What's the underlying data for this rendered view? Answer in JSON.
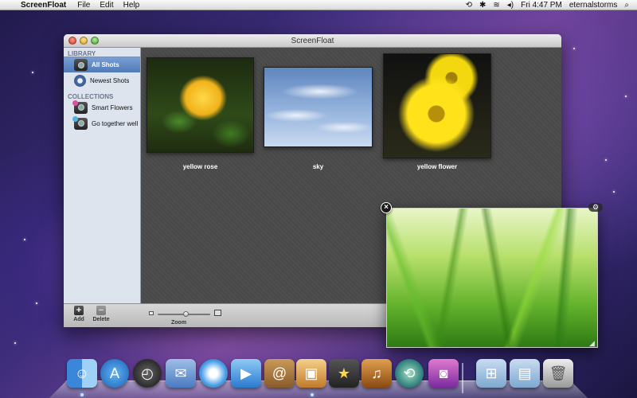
{
  "menubar": {
    "app_name": "ScreenFloat",
    "menus": [
      "File",
      "Edit",
      "Help"
    ],
    "clock": "Fri 4:47 PM",
    "user": "eternalstorms"
  },
  "window": {
    "title": "ScreenFloat"
  },
  "sidebar": {
    "library_header": "LIBRARY",
    "library_items": [
      {
        "label": "All Shots",
        "icon": "camera-icon"
      },
      {
        "label": "Newest Shots",
        "icon": "clock-icon"
      }
    ],
    "collections_header": "COLLECTIONS",
    "collection_items": [
      {
        "label": "Smart Flowers",
        "icon": "smart-collection-icon"
      },
      {
        "label": "Go together well",
        "icon": "collection-icon"
      }
    ]
  },
  "shots": [
    {
      "label": "yellow rose"
    },
    {
      "label": "sky"
    },
    {
      "label": "yellow flower"
    }
  ],
  "toolbar": {
    "add_label": "Add",
    "delete_label": "Delete",
    "zoom_label": "Zoom",
    "zoom_value": 0.55
  },
  "float_panel": {
    "image": "grass-image"
  },
  "dock": [
    "finder",
    "app-store",
    "dashboard",
    "mail",
    "safari",
    "facetime",
    "address-book",
    "iphoto",
    "imovie",
    "garageband",
    "time-machine",
    "photo-booth",
    "applications-folder",
    "documents-folder",
    "trash"
  ]
}
